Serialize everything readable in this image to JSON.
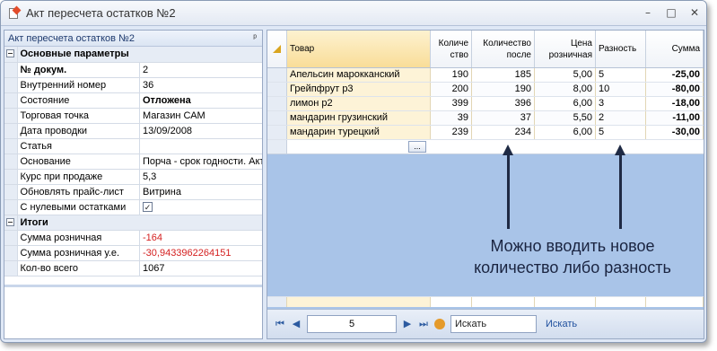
{
  "window": {
    "title": "Акт пересчета остатков №2",
    "min_glyph": "–",
    "max_glyph": "□",
    "close_glyph": "✕"
  },
  "left_panel": {
    "header": "Акт пересчета остатков №2",
    "pin_glyph": "ᵖ",
    "sections": [
      {
        "title": "Основные параметры",
        "rows": [
          {
            "name": "№ докум.",
            "value": "2",
            "name_bold": true
          },
          {
            "name": "Внутренний номер",
            "value": "36"
          },
          {
            "name": "Состояние",
            "value": "Отложена",
            "value_bold": true
          },
          {
            "name": "Торговая точка",
            "value": "Магазин САМ"
          },
          {
            "name": "Дата проводки",
            "value": "13/09/2008"
          },
          {
            "name": "Статья",
            "value": ""
          },
          {
            "name": "Основание",
            "value": "Порча - срок годности. Акт"
          },
          {
            "name": "Курс при продаже",
            "value": "5,3"
          },
          {
            "name": "Обновлять прайс-лист",
            "value": "Витрина"
          },
          {
            "name": "С нулевыми остатками",
            "value": "✓",
            "checkbox": true
          }
        ]
      },
      {
        "title": "Итоги",
        "rows": [
          {
            "name": "Сумма розничная",
            "value": "-164",
            "red": true
          },
          {
            "name": "Сумма розничная у.е.",
            "value": "-30,9433962264151",
            "red": true
          },
          {
            "name": "Кол-во всего",
            "value": "1067"
          }
        ]
      }
    ]
  },
  "grid": {
    "columns": [
      {
        "label": "Товар"
      },
      {
        "label": "Количе ство"
      },
      {
        "label": "Количество после"
      },
      {
        "label": "Цена розничная"
      },
      {
        "label": "Разность"
      },
      {
        "label": "Сумма"
      }
    ],
    "rows": [
      {
        "product": "Апельсин марокканский",
        "qty": "190",
        "qty_after": "185",
        "price": "5,00",
        "diff": "5",
        "sum": "-25,00"
      },
      {
        "product": "Грейпфрут p3",
        "qty": "200",
        "qty_after": "190",
        "price": "8,00",
        "diff": "10",
        "sum": "-80,00"
      },
      {
        "product": "лимон p2",
        "qty": "399",
        "qty_after": "396",
        "price": "6,00",
        "diff": "3",
        "sum": "-18,00"
      },
      {
        "product": "мандарин грузинский",
        "qty": "39",
        "qty_after": "37",
        "price": "5,50",
        "diff": "2",
        "sum": "-11,00"
      },
      {
        "product": "мандарин турецкий",
        "qty": "239",
        "qty_after": "234",
        "price": "6,00",
        "diff": "5",
        "sum": "-30,00"
      }
    ],
    "ellipsis": "...",
    "annotation_line1": "Можно вводить новое",
    "annotation_line2": "количество либо разность"
  },
  "navigator": {
    "first": "⏮",
    "prev": "◀",
    "page": "5",
    "next": "▶",
    "last": "⏭",
    "search_placeholder": "Искать",
    "search_button": "Искать"
  }
}
